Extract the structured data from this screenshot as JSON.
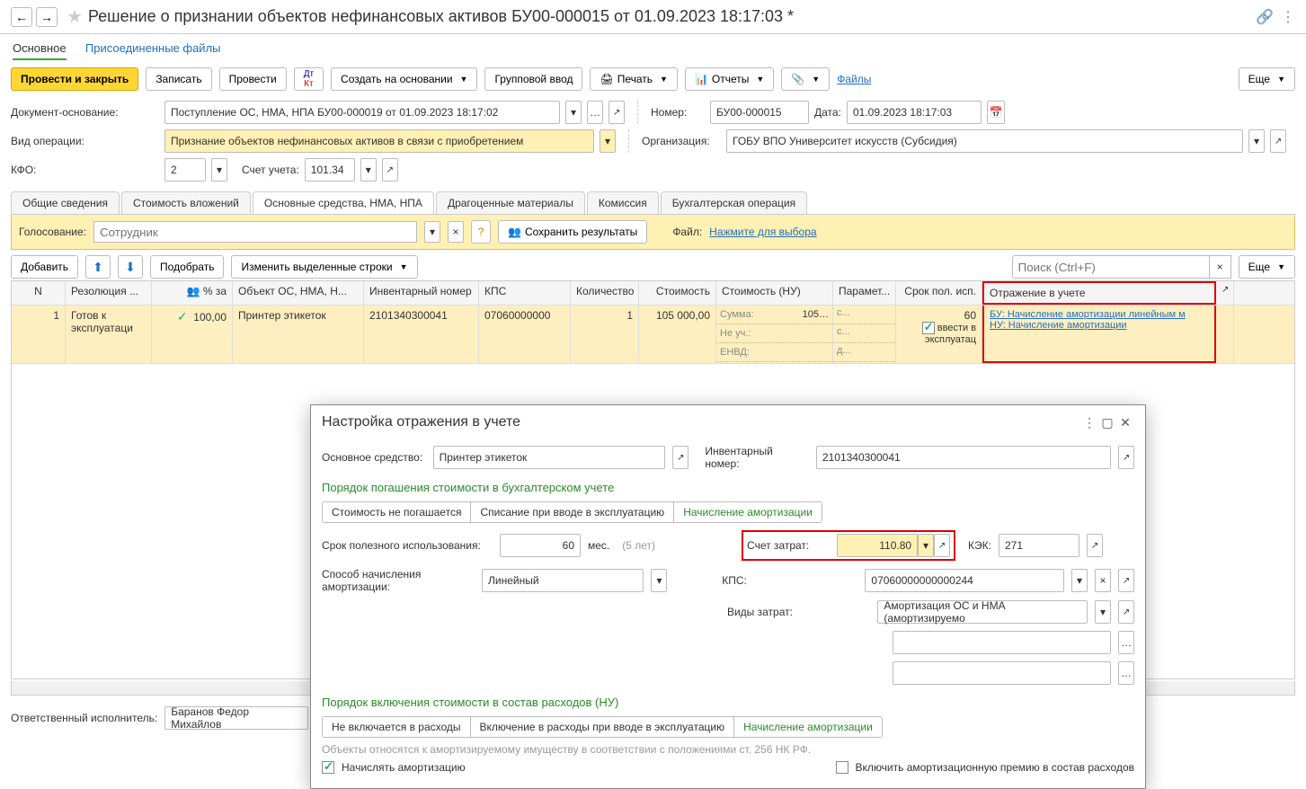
{
  "title": "Решение о признании объектов нефинансовых активов БУ00-000015 от 01.09.2023 18:17:03 *",
  "subnav": {
    "main": "Основное",
    "files": "Присоединенные файлы"
  },
  "toolbar": {
    "post_close": "Провести и закрыть",
    "save": "Записать",
    "post": "Провести",
    "create_based": "Создать на основании",
    "group_input": "Групповой ввод",
    "print": "Печать",
    "reports": "Отчеты",
    "files_link": "Файлы",
    "more": "Еще"
  },
  "form": {
    "doc_base_lbl": "Документ-основание:",
    "doc_base_val": "Поступление ОС, НМА, НПА БУ00-000019 от 01.09.2023 18:17:02",
    "number_lbl": "Номер:",
    "number_val": "БУ00-000015",
    "date_lbl": "Дата:",
    "date_val": "01.09.2023 18:17:03",
    "op_lbl": "Вид операции:",
    "op_val": "Признание объектов нефинансовых активов в связи с приобретением",
    "org_lbl": "Организация:",
    "org_val": "ГОБУ ВПО Университет искусств (Субсидия)",
    "kfo_lbl": "КФО:",
    "kfo_val": "2",
    "acct_lbl": "Счет учета:",
    "acct_val": "101.34"
  },
  "tabs": {
    "t1": "Общие сведения",
    "t2": "Стоимость вложений",
    "t3": "Основные средства, НМА, НПА",
    "t4": "Драгоценные материалы",
    "t5": "Комиссия",
    "t6": "Бухгалтерская операция"
  },
  "vote": {
    "lbl": "Голосование:",
    "placeholder": "Сотрудник",
    "save_res": "Сохранить результаты",
    "file_lbl": "Файл:",
    "file_link": "Нажмите для выбора"
  },
  "tb2": {
    "add": "Добавить",
    "pick": "Подобрать",
    "change_rows": "Изменить выделенные строки",
    "search_ph": "Поиск (Ctrl+F)",
    "more": "Еще"
  },
  "grid": {
    "head": {
      "n": "N",
      "res": "Резолюция ...",
      "pct": "% за",
      "obj": "Объект ОС, НМА, Н...",
      "inv": "Инвентарный номер",
      "kps": "КПС",
      "qty": "Количество",
      "sum": "Стоимость",
      "sumnu": "Стоимость (НУ)",
      "par": "Парамет...",
      "srok": "Срок пол. исп.",
      "otr": "Отражение в учете"
    },
    "row": {
      "n": "1",
      "res": "Готов к эксплуатаци",
      "pct": "100,00",
      "obj": "Принтер этикеток",
      "inv": "2101340300041",
      "kps": "07060000000",
      "qty": "1",
      "sum": "105 000,00",
      "sumnu_lbl1": "Сумма:",
      "sumnu_val1": "105…",
      "sumnu_lbl2": "Не уч.:",
      "sumnu_lbl3": "ЕНВД:",
      "par1": "с...",
      "par2": "с...",
      "par3": "д...",
      "srok": "60",
      "srok_chk": "ввести в эксплуатац",
      "otr1": "БУ: Начисление амортизации линейным м",
      "otr2": "НУ: Начисление амортизации"
    }
  },
  "footer": {
    "resp_lbl": "Ответственный исполнитель:",
    "resp_val": "Баранов Федор Михайлов"
  },
  "dialog": {
    "title": "Настройка отражения в учете",
    "os_lbl": "Основное средство:",
    "os_val": "Принтер этикеток",
    "inv_lbl": "Инвентарный номер:",
    "inv_val": "2101340300041",
    "sec1": "Порядок погашения стоимости в бухгалтерском учете",
    "opt1a": "Стоимость не погашается",
    "opt1b": "Списание при вводе в эксплуатацию",
    "opt1c": "Начисление амортизации",
    "life_lbl": "Срок полезного использования:",
    "life_val": "60",
    "life_unit": "мес.",
    "life_hint": "(5 лет)",
    "cost_acc_lbl": "Счет затрат:",
    "cost_acc_val": "110.80",
    "kek_lbl": "КЭК:",
    "kek_val": "271",
    "method_lbl": "Способ начисления амортизации:",
    "method_val": "Линейный",
    "kps_lbl": "КПС:",
    "kps_val": "07060000000000244",
    "cost_type_lbl": "Виды затрат:",
    "cost_type_val": "Амортизация ОС и НМА (амортизируемо",
    "sec2": "Порядок включения стоимости в состав расходов (НУ)",
    "opt2a": "Не включается в расходы",
    "opt2b": "Включение в расходы при вводе в эксплуатацию",
    "opt2c": "Начисление амортизации",
    "note": "Объекты относятся к амортизируемому имуществу в соответствии с положениями ст. 256 НК РФ.",
    "chk1": "Начислять амортизацию",
    "chk2": "Включить амортизационную премию в состав расходов"
  }
}
